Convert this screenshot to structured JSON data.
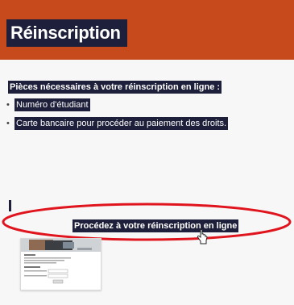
{
  "banner": {
    "title": "Réinscription"
  },
  "pieces": {
    "heading": "Pièces nécessaires à votre réinscription en ligne :",
    "items": [
      "Numéro d'étudiant",
      "Carte bancaire pour procéder au paiement des droits."
    ]
  },
  "cta": {
    "label": "Procédez à votre réinscription en ligne"
  },
  "colors": {
    "banner": "#c64a1c",
    "highlight": "#1e1f3a",
    "annotation": "#e0141c",
    "background": "#f7f7f7"
  },
  "icons": {
    "cursor": "hand-pointer-icon",
    "thumbnail": "screenshot-thumbnail"
  }
}
